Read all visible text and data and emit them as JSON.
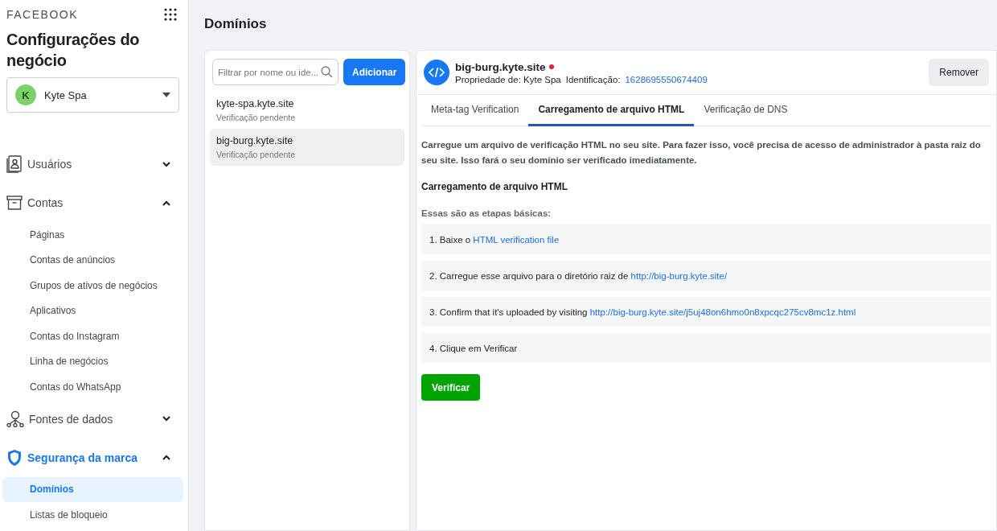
{
  "sidebar": {
    "brand": "FACEBOOK",
    "title": "Configurações do negócio",
    "account": {
      "initial": "K",
      "name": "Kyte Spa"
    },
    "sections": [
      {
        "label": "Usuários",
        "expanded": false,
        "selected": false
      },
      {
        "label": "Contas",
        "expanded": true,
        "selected": false,
        "children": [
          {
            "label": "Páginas",
            "selected": false
          },
          {
            "label": "Contas de anúncios",
            "selected": false
          },
          {
            "label": "Grupos de ativos de negócios",
            "selected": false
          },
          {
            "label": "Aplicativos",
            "selected": false
          },
          {
            "label": "Contas do Instagram",
            "selected": false
          },
          {
            "label": "Linha de negócios",
            "selected": false
          },
          {
            "label": "Contas do WhatsApp",
            "selected": false
          }
        ]
      },
      {
        "label": "Fontes de dados",
        "expanded": false,
        "selected": false
      },
      {
        "label": "Segurança da marca",
        "expanded": true,
        "selected": true,
        "children": [
          {
            "label": "Domínios",
            "selected": true
          },
          {
            "label": "Listas de bloqueio",
            "selected": false
          }
        ]
      }
    ]
  },
  "page_title": "Domínios",
  "domain_list": {
    "search": {
      "placeholder": "Filtrar por nome ou ide..."
    },
    "add_button": "Adicionar",
    "items": [
      {
        "name": "kyte-spa.kyte.site",
        "status": "Verificação pendente",
        "selected": false
      },
      {
        "name": "big-burg.kyte.site",
        "status": "Verificação pendente",
        "selected": true
      }
    ]
  },
  "detail": {
    "name": "big-burg.kyte.site",
    "verified": false,
    "owner": "Propriedade de: Kyte Spa",
    "id_label": "Identificação:",
    "id": "1628695550674409",
    "remove_button": "Remover",
    "tabs": [
      {
        "label": "Meta-tag Verification",
        "selected": false
      },
      {
        "label": "Carregamento de arquivo HTML",
        "selected": true
      },
      {
        "label": "Verificação de DNS",
        "selected": false
      }
    ],
    "description": "Carregue um arquivo de verificação HTML no seu site. Para fazer isso, você precisa de acesso de administrador à pasta raiz do seu site. Isso fará o seu domínio ser verificado imediatamente.",
    "section_title": "Carregamento de arquivo HTML",
    "steps_intro": "Essas são as etapas básicas:",
    "steps": [
      {
        "text": "1. Baixe o ",
        "link": "HTML verification file"
      },
      {
        "text": "2. Carregue esse arquivo para o diretório raiz de ",
        "link": "http://big-burg.kyte.site/"
      },
      {
        "text": "3. Confirm that it's uploaded by visiting ",
        "link": "http://big-burg.kyte.site/j5uj48on6hmo0n8xpcqc275cv8mc1z.html"
      },
      {
        "text": "4. Clique em Verificar"
      }
    ],
    "verify_button": "Verificar"
  }
}
